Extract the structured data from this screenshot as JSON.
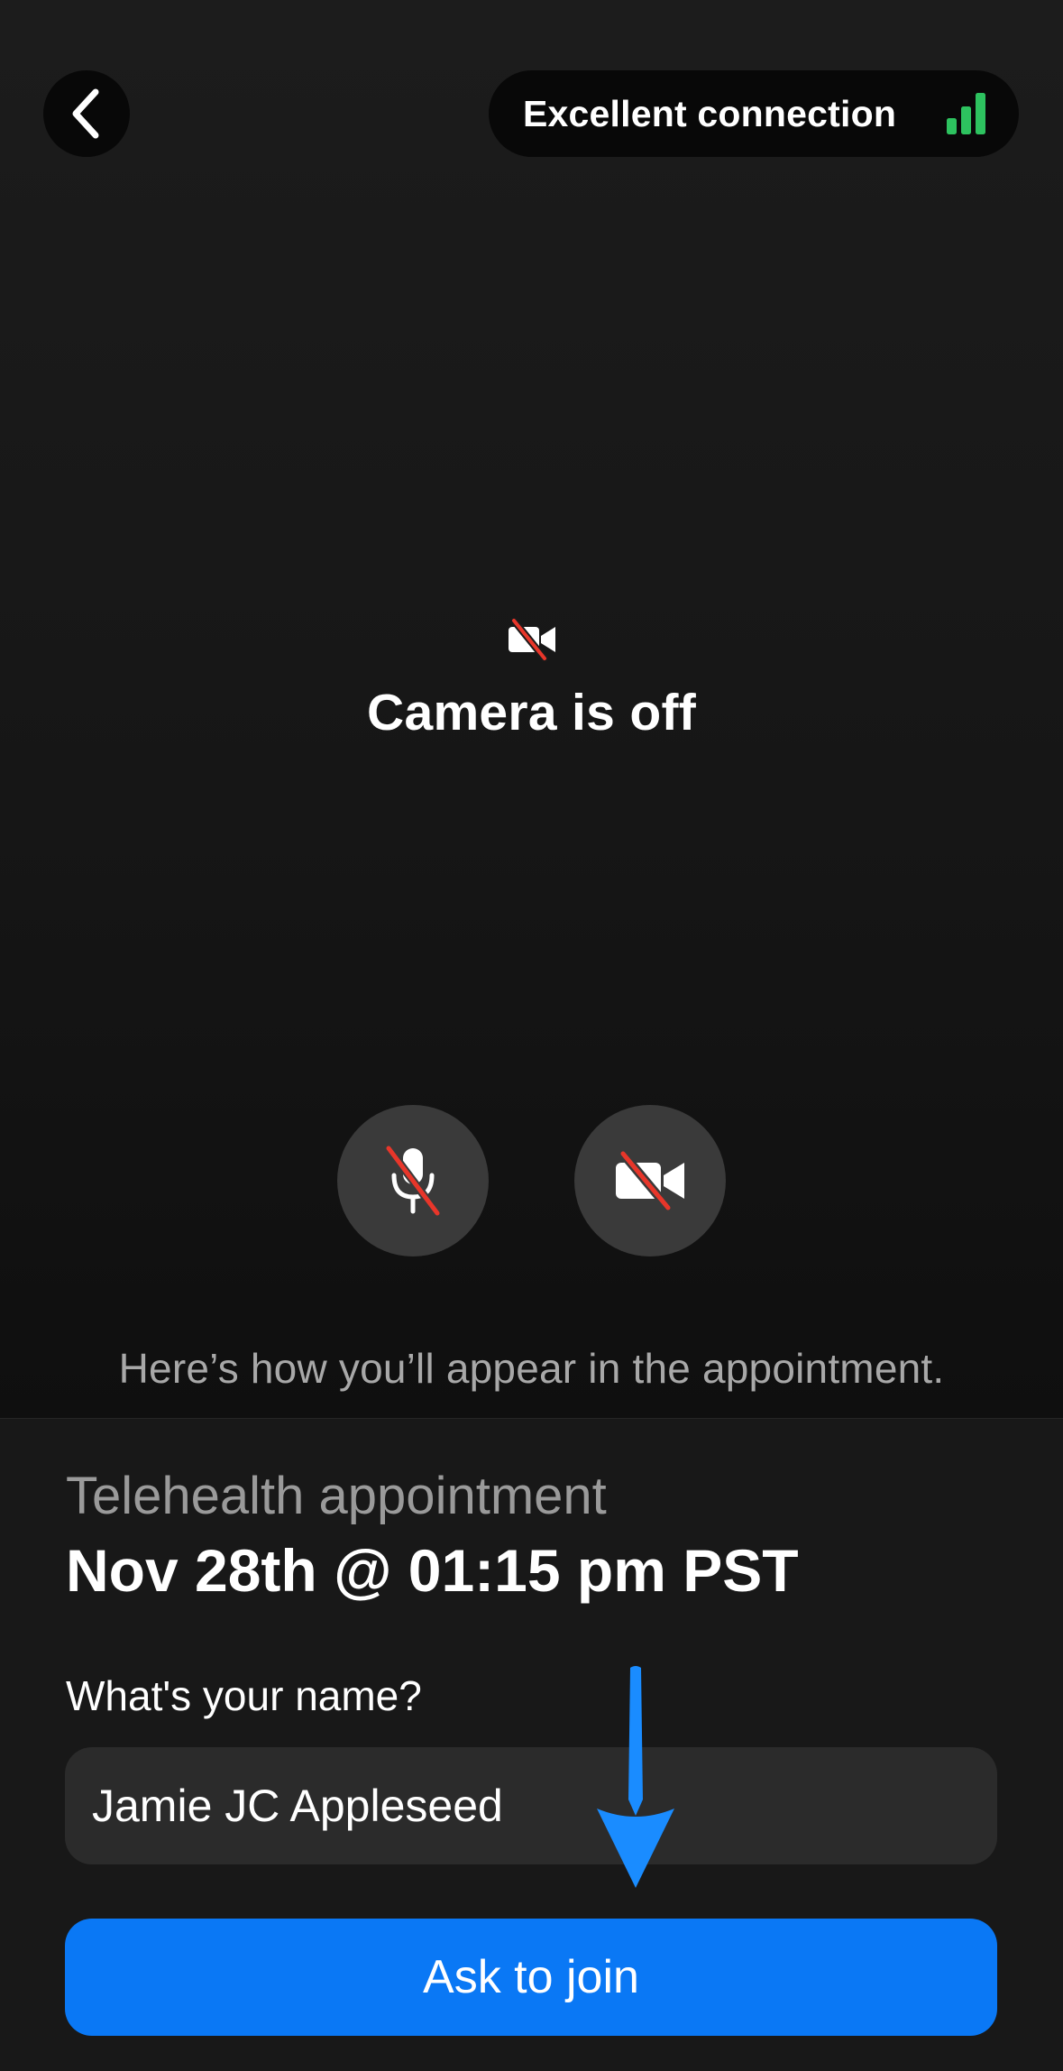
{
  "header": {
    "back_label": "Back",
    "connection_text": "Excellent connection",
    "signal_color": "#2dc25f"
  },
  "preview": {
    "camera_status": "Camera is off",
    "mic_button_label": "Microphone off",
    "camera_button_label": "Camera off",
    "appear_text": "Here’s how you’ll appear in the appointment.",
    "slash_color": "#e8362a"
  },
  "appointment": {
    "label": "Telehealth appointment",
    "datetime": "Nov 28th @ 01:15 pm PST"
  },
  "form": {
    "name_label": "What's your name?",
    "name_value": "Jamie JC Appleseed",
    "join_label": "Ask to join",
    "accent_color": "#0a78f5"
  },
  "annotation": {
    "arrow_color": "#1a8cff"
  }
}
